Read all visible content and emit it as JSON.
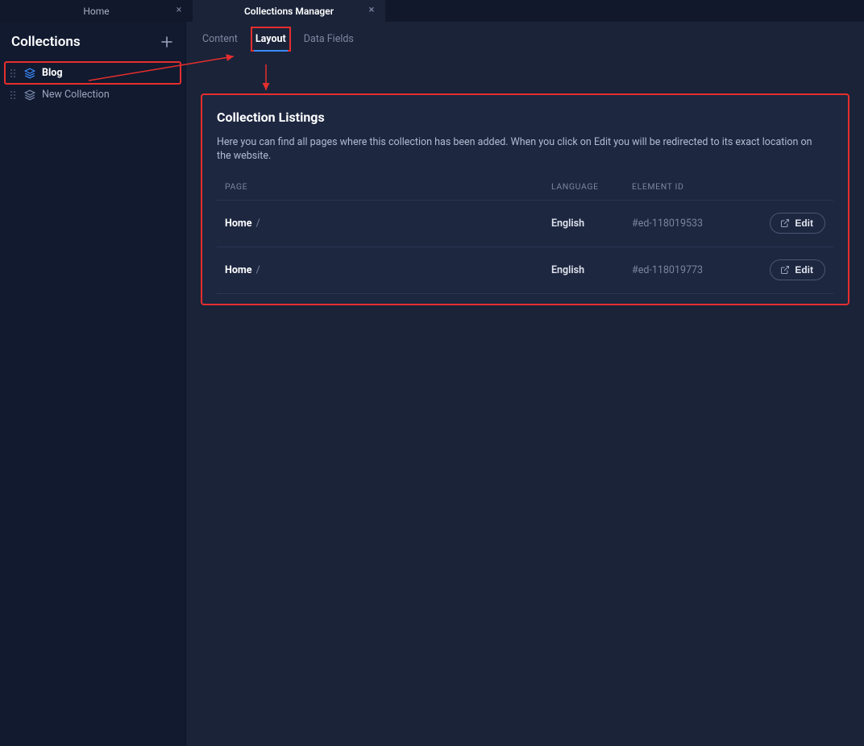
{
  "tabs": [
    {
      "label": "Home",
      "active": false
    },
    {
      "label": "Collections Manager",
      "active": true
    }
  ],
  "sidebar": {
    "title": "Collections",
    "items": [
      {
        "label": "Blog",
        "active": true
      },
      {
        "label": "New Collection",
        "active": false
      }
    ]
  },
  "subtabs": [
    {
      "label": "Content",
      "active": false
    },
    {
      "label": "Layout",
      "active": true
    },
    {
      "label": "Data Fields",
      "active": false
    }
  ],
  "panel": {
    "title": "Collection Listings",
    "description": "Here you can find all pages where this collection has been added. When you click on Edit you will be redirected to its exact location on the website.",
    "columns": {
      "page": "PAGE",
      "language": "LANGUAGE",
      "element_id": "ELEMENT ID"
    },
    "edit_label": "Edit",
    "rows": [
      {
        "page": "Home",
        "slash": "/",
        "language": "English",
        "element_id": "#ed-118019533"
      },
      {
        "page": "Home",
        "slash": "/",
        "language": "English",
        "element_id": "#ed-118019773"
      }
    ]
  }
}
